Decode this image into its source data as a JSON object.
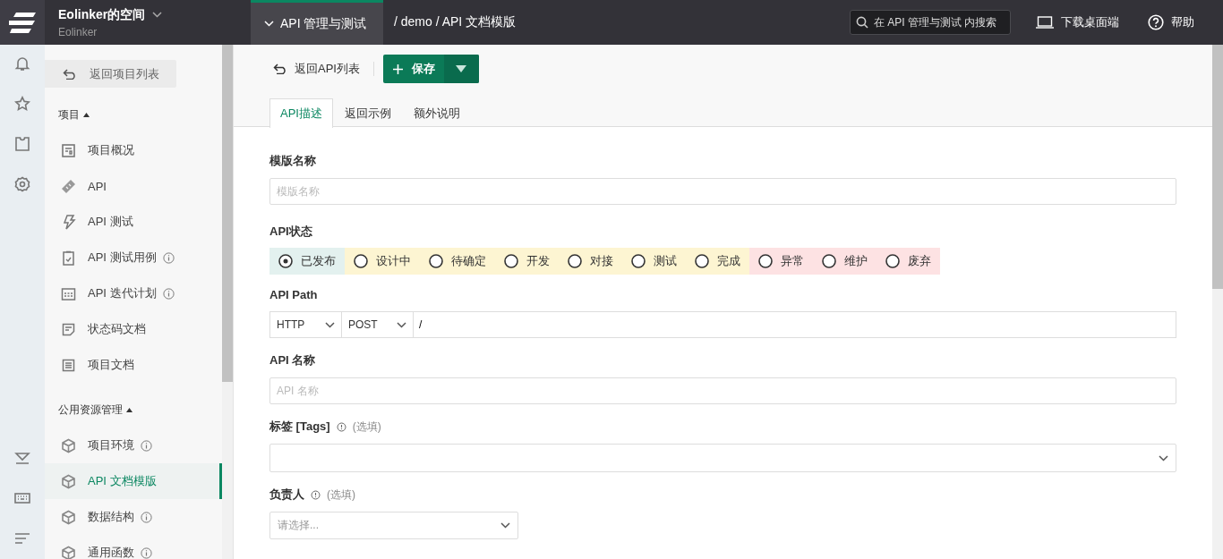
{
  "topbar": {
    "workspace": "Eolinker的空间",
    "workspace_sub": "Eolinker",
    "product": "API 管理与测试",
    "breadcrumb": "/ demo / API 文档模版",
    "search": {
      "placeholder": "在 API 管理与测试 内搜索"
    },
    "download": "下载桌面端",
    "help": "帮助"
  },
  "sidebar": {
    "back": "返回项目列表",
    "sections": [
      {
        "title": "项目",
        "expanded": true,
        "items": [
          {
            "label": "项目概况",
            "info": false,
            "selected": false
          },
          {
            "label": "API",
            "info": false,
            "selected": false
          },
          {
            "label": "API 测试",
            "info": false,
            "selected": false
          },
          {
            "label": "API 测试用例",
            "info": true,
            "selected": false
          },
          {
            "label": "API 迭代计划",
            "info": true,
            "selected": false
          },
          {
            "label": "状态码文档",
            "info": false,
            "selected": false
          },
          {
            "label": "项目文档",
            "info": false,
            "selected": false
          }
        ]
      },
      {
        "title": "公用资源管理",
        "expanded": true,
        "items": [
          {
            "label": "项目环境",
            "info": true,
            "selected": false
          },
          {
            "label": "API 文档模版",
            "info": false,
            "selected": true
          },
          {
            "label": "数据结构",
            "info": true,
            "selected": false
          },
          {
            "label": "通用函数",
            "info": true,
            "selected": false
          }
        ]
      }
    ]
  },
  "toolbar": {
    "back": "返回API列表",
    "save": "保存",
    "tabs": [
      {
        "label": "API描述",
        "selected": true
      },
      {
        "label": "返回示例",
        "selected": false
      },
      {
        "label": "额外说明",
        "selected": false
      }
    ]
  },
  "form": {
    "template_name": {
      "label": "模版名称",
      "placeholder": "模版名称"
    },
    "status": {
      "label": "API状态",
      "options": [
        {
          "label": "已发布",
          "selected": true,
          "color": "#e3f1ef"
        },
        {
          "label": "设计中",
          "selected": false,
          "color": "#fdf5d2"
        },
        {
          "label": "待确定",
          "selected": false,
          "color": "#fdf5d2"
        },
        {
          "label": "开发",
          "selected": false,
          "color": "#fdf5d2"
        },
        {
          "label": "对接",
          "selected": false,
          "color": "#fdf5d2"
        },
        {
          "label": "测试",
          "selected": false,
          "color": "#fdf5d2"
        },
        {
          "label": "完成",
          "selected": false,
          "color": "#fdf5d2"
        },
        {
          "label": "异常",
          "selected": false,
          "color": "#fde2e3"
        },
        {
          "label": "维护",
          "selected": false,
          "color": "#fde2e3"
        },
        {
          "label": "废弃",
          "selected": false,
          "color": "#fde2e3"
        }
      ]
    },
    "path": {
      "label": "API Path",
      "protocol": "HTTP",
      "method": "POST",
      "value": "/"
    },
    "api_name": {
      "label": "API 名称",
      "placeholder": "API 名称"
    },
    "tags": {
      "label": "标签 [Tags]",
      "hint": "(选填)"
    },
    "owner": {
      "label": "负责人",
      "hint": "(选填)",
      "placeholder": "请选择..."
    }
  }
}
